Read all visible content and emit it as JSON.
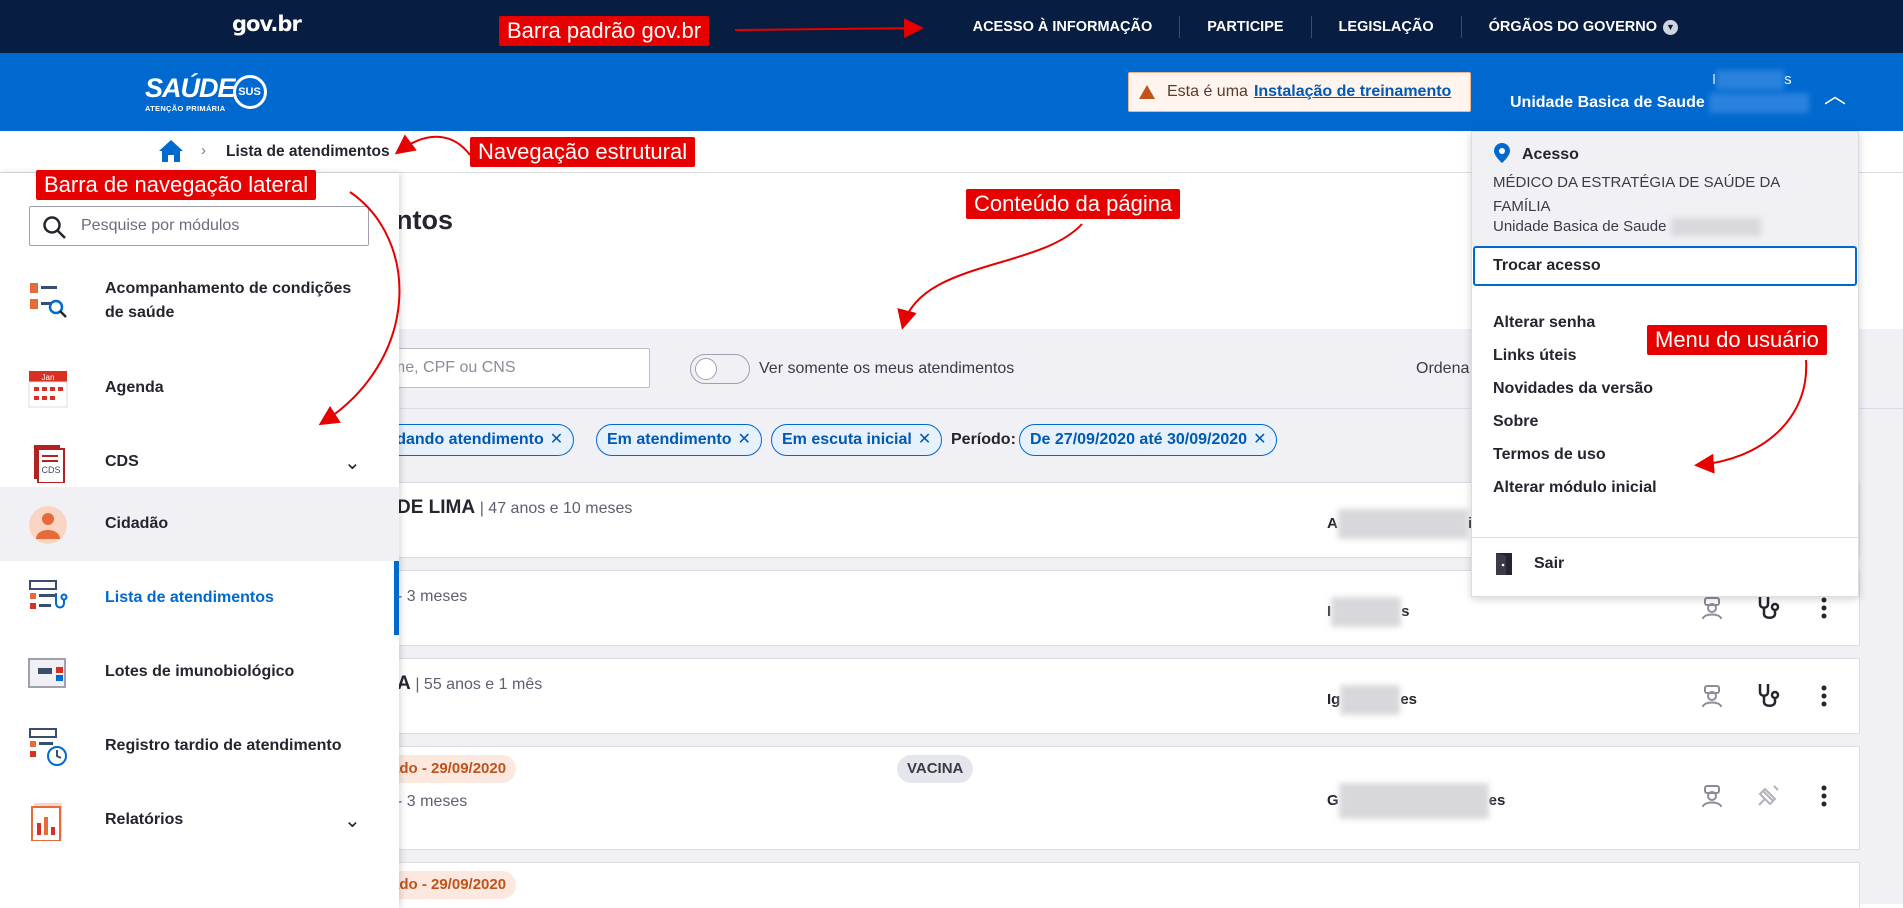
{
  "govbar": {
    "logo": "gov.br",
    "links": [
      "ACESSO À INFORMAÇÃO",
      "PARTICIPE",
      "LEGISLAÇÃO",
      "ÓRGÃOS DO GOVERNO"
    ]
  },
  "header": {
    "logo_main": "SAÚDE",
    "logo_badge": "SUS",
    "logo_sub": "ATENÇÃO PRIMÁRIA",
    "training_text": "Esta é uma",
    "training_link": "Instalação de treinamento",
    "user_initial": "I",
    "user_tail": "s",
    "user_unit": "Unidade Basica de Saude"
  },
  "breadcrumb": {
    "current": "Lista de atendimentos"
  },
  "page": {
    "title_fragment": "ntos",
    "search_placeholder": "ome, CPF ou CNS",
    "toggle_label": "Ver somente os meus atendimentos",
    "sort_label": "Ordena",
    "chips": [
      "rdando atendimento",
      "Em atendimento",
      "Em escuta inicial"
    ],
    "period_label": "Período:",
    "period_chip": "De 27/09/2020 até 30/09/2020"
  },
  "rows": [
    {
      "name": "DE LIMA",
      "age": "47 anos e 10 meses",
      "sub": "",
      "badge": "",
      "badge2": "",
      "prof_start": "A",
      "prof_end": "i"
    },
    {
      "name": "",
      "age": "",
      "sub": "- 3 meses",
      "badge": "",
      "badge2": "",
      "prof_start": "I",
      "prof_end": "s"
    },
    {
      "name": "A",
      "age": "55 anos e 1 mês",
      "sub": "",
      "badge": "",
      "badge2": "",
      "prof_start": "Ig",
      "prof_end": "es"
    },
    {
      "name": "",
      "age": "",
      "sub": "- 3 meses",
      "badge": "ado - 29/09/2020",
      "badge2": "VACINA",
      "prof_start": "G",
      "prof_end": "es"
    },
    {
      "name": "",
      "age": "",
      "sub": "",
      "badge": "ado - 29/09/2020",
      "badge2": "",
      "prof_start": "",
      "prof_end": ""
    }
  ],
  "sidebar": {
    "search_placeholder": "Pesquise por módulos",
    "items": [
      {
        "label": "Acompanhamento de condições de saúde",
        "icon": "health-conditions-icon"
      },
      {
        "label": "Agenda",
        "icon": "calendar-icon",
        "icon_text": "Jan"
      },
      {
        "label": "CDS",
        "icon": "cds-document-icon",
        "icon_text": "CDS"
      },
      {
        "label": "Cidadão",
        "icon": "citizen-icon"
      },
      {
        "label": "Lista de atendimentos",
        "icon": "attendance-list-icon"
      },
      {
        "label": "Lotes de imunobiológico",
        "icon": "immunobiological-icon"
      },
      {
        "label": "Registro tardio de atendimento",
        "icon": "late-register-icon"
      },
      {
        "label": "Relatórios",
        "icon": "reports-icon"
      }
    ]
  },
  "user_menu": {
    "acesso_title": "Acesso",
    "role": "MÉDICO DA ESTRATÉGIA DE SAÚDE DA FAMÍLIA",
    "unit": "Unidade Basica de Saude",
    "trocar": "Trocar acesso",
    "items": [
      "Alterar senha",
      "Links úteis",
      "Novidades da versão",
      "Sobre",
      "Termos de uso",
      "Alterar módulo inicial"
    ],
    "sair": "Sair"
  },
  "annotations": {
    "govbar": "Barra padrão gov.br",
    "breadcrumb": "Navegação estrutural",
    "sidebar": "Barra de navegação lateral",
    "content": "Conteúdo da página",
    "usermenu": "Menu do usuário"
  },
  "colors": {
    "gov_navy": "#071d41",
    "header_blue": "#0069d0",
    "annotation_red": "#e60000",
    "chip_blue": "#0059b3",
    "orange": "#c0531a"
  }
}
